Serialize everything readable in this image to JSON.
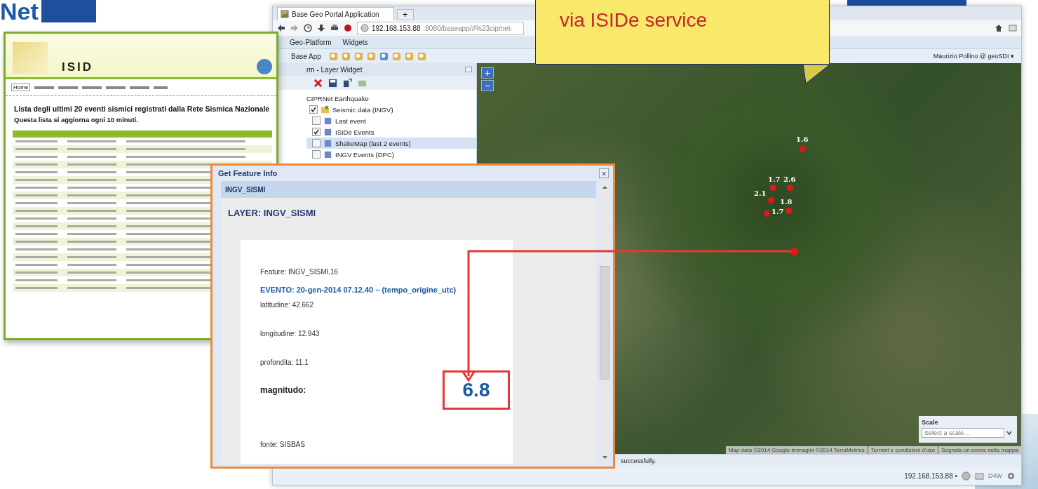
{
  "logo": {
    "text": "Net"
  },
  "isid": {
    "brand": "ISID",
    "tab": "Home",
    "heading": "Lista degli ultimi 20 eventi sismici registrati dalla Rete Sismica Nazionale",
    "subheading": "Questa lista si aggiorna ogni 10 minuti."
  },
  "browser": {
    "tab_title": "Base Geo Portal Application",
    "new_tab": "+",
    "url_host": "192.168.153.88",
    "url_rest": ":8080/baseapp/#%23cipmet-",
    "menu": [
      "Geo-Platform",
      "Widgets"
    ],
    "toolbar_label": "Base App",
    "user": "Maurizio Pollino @ geoSDI ▾",
    "layer_panel": {
      "title": "rm - Layer Widget",
      "root": "CIPRNet Earthquake",
      "group": {
        "label": "Seismic data (INGV)",
        "checked": true,
        "children": [
          {
            "label": "Last event",
            "checked": false,
            "selected": false
          },
          {
            "label": "ISIDe Events",
            "checked": true,
            "selected": false
          },
          {
            "label": "ShakeMap (last 2 events)",
            "checked": false,
            "selected": true
          },
          {
            "label": "INGV Events (DPC)",
            "checked": false,
            "selected": false
          }
        ]
      }
    },
    "map": {
      "zoom_in": "+",
      "zoom_out": "−",
      "markers": [
        {
          "label": "1.6"
        },
        {
          "label": "1.7"
        },
        {
          "label": "2.6"
        },
        {
          "label": "2.1"
        },
        {
          "label": "1.8"
        },
        {
          "label": "1.7"
        }
      ],
      "scale": {
        "title": "Scale",
        "placeholder": "Select a scale..."
      },
      "attribution": [
        "Map data ©2014 Google Immagini ©2014 TerraMetrics",
        "Termini e condizioni d'uso",
        "Segnala un errore nella mappa"
      ]
    },
    "status": "successfully.",
    "footer_host": "192.168.153.88 •",
    "footer_tag": "D4W"
  },
  "callout": {
    "text": "via ISIDe service"
  },
  "dialog": {
    "title": "Get Feature Info",
    "close": "×",
    "section": "INGV_SISMI",
    "layer": "LAYER: INGV_SISMI",
    "feature": "Feature: INGV_SISMI.16",
    "event": "EVENTO: 20-gen-2014  07.12.40 – (tempo_origine_utc)",
    "fields": [
      "latitudine: 42.662",
      "longitudine: 12.943",
      "profondita: 11.1"
    ],
    "magnitude_label": "magnitudo:",
    "magnitude": "6.8",
    "source": "fonte: SISBAS"
  }
}
